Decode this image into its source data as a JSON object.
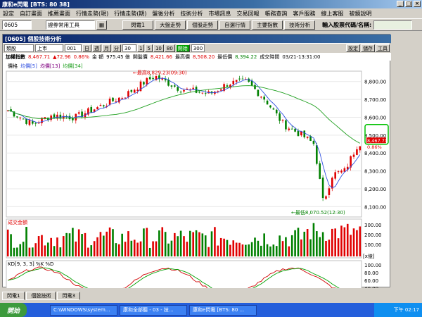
{
  "app": {
    "title": "康和e閃電 [BTS: 80 38]"
  },
  "menu": [
    "設定",
    "自訂畫面",
    "推薦畫面",
    "行情走勢(現)",
    "行情走勢(期)",
    "盤後分析",
    "技術分析",
    "市場訊息",
    "交易回報",
    "帳務查詢",
    "客戶服務",
    "線上客服",
    "被鏡說明"
  ],
  "toolbar": {
    "code": "0605",
    "tools": "證券常用工具",
    "buttons": [
      "閃電1",
      "大盤走勢",
      "個股走勢",
      "自選行情",
      "主要指數",
      "技術分析"
    ],
    "search_label": "輸入股票代碼/名稱:"
  },
  "window": {
    "title": "[0605] 個股技術分析",
    "controls": {
      "period": "類股",
      "market": "上市",
      "item": "001",
      "units": [
        "日",
        "週",
        "月",
        "分"
      ],
      "interval": "30",
      "steps": [
        "1",
        "5",
        "10",
        "80"
      ],
      "count_label": "開始",
      "count": "300",
      "right": [
        "設定",
        "儲存",
        "工具"
      ]
    },
    "info": {
      "name": "加權指數",
      "price": "8,467.71",
      "change": "▲72.96",
      "pct": "0.86%",
      "amount_label": "金 額",
      "amount": "975.45 億",
      "open_label": "開盤價",
      "open": "8,421.66",
      "high_label": "最高價",
      "high": "8,508.20",
      "low_label": "最低價",
      "low": "8,394.22",
      "time_label": "成交時間",
      "time": "03/21-13:31:00"
    },
    "price_panel": {
      "legend": [
        "價格",
        "均價[5]",
        "均價[13]",
        "均價[34]"
      ],
      "annotation_high": "←最高8,829.23(09:30)",
      "annotation_low": "←最低8,070.52(12:30)",
      "axis": [
        "8,800.00",
        "8,700.00",
        "8,600.00",
        "8,500.00",
        "8,400.00",
        "8,300.00",
        "8,200.00",
        "8,100.00"
      ],
      "badge_price": "8,467.71",
      "badge_pct": "0.86%"
    },
    "volume_panel": {
      "label": "成交金額",
      "axis": [
        "300.00",
        "200.00",
        "100.00"
      ],
      "unit": "[x億]"
    },
    "kd_panel": {
      "label": "KD[9, 3, 3]",
      "k": "%K",
      "d": "%D",
      "axis": [
        "100.00",
        "80.00",
        "60.00",
        "40.00",
        "20.00"
      ]
    },
    "xaxis": [
      "09:30",
      "02/24",
      "02/25",
      "12",
      "03/01",
      "12",
      "03/02",
      "12",
      "03/03",
      "12",
      "03/04",
      "12",
      "03/07",
      "12",
      "03/08",
      "12",
      "03/09",
      "12",
      "03/10",
      "12",
      "03/11",
      "12",
      "03/14",
      "12",
      "03/15",
      "12",
      "03/16",
      "12",
      "03/17",
      "12",
      "03/18",
      "12",
      "03/21",
      "13:30"
    ]
  },
  "tabs": [
    "閃電1",
    "個股技術",
    "閃電3"
  ],
  "taskbar": {
    "start": "開始",
    "tasks": [
      "C:\\WINDOWS\\system...",
      "康和全部聽 - 03 - 技...",
      "康和e閃電 [BTS: 80 ..."
    ],
    "clock": "下午 02:17"
  },
  "colors": {
    "up": "#e00000",
    "down": "#008000",
    "ma5": "#3050e0",
    "ma34": "#20a020",
    "kd_k": "#d00000",
    "kd_d": "#00a000"
  }
}
